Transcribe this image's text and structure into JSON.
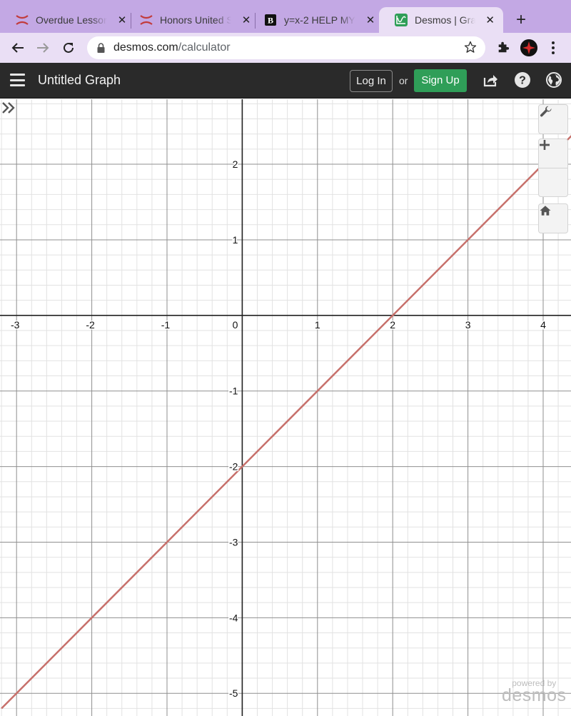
{
  "browser": {
    "tabs": [
      {
        "title": "Overdue Lessons",
        "icon": "edgenuity-x-icon",
        "active": false
      },
      {
        "title": "Honors United States",
        "icon": "edgenuity-x-icon",
        "active": false
      },
      {
        "title": "y=x-2 HELP MY",
        "icon": "brainly-b-icon",
        "active": false
      },
      {
        "title": "Desmos | Graphing Calculator",
        "icon": "desmos-icon",
        "active": true
      }
    ],
    "new_tab_label": "+",
    "close_label": "✕",
    "url_host": "desmos.com",
    "url_path": "/calculator"
  },
  "desmos": {
    "graph_title": "Untitled Graph",
    "login_label": "Log In",
    "or_label": "or",
    "signup_label": "Sign Up",
    "signup_color": "#2f9e58",
    "powered_by": "powered by",
    "brand": "desmos"
  },
  "chart_data": {
    "type": "line",
    "title": "",
    "expression": "y = x - 2",
    "series": [
      {
        "name": "y = x - 2",
        "color": "#c7706b",
        "slope": 1,
        "intercept": -2,
        "points": [
          [
            -3.2,
            -5.2
          ],
          [
            4.4,
            2.4
          ]
        ]
      }
    ],
    "xlim": [
      -3.22,
      4.37
    ],
    "ylim": [
      -5.3,
      2.86
    ],
    "x_ticks": [
      -3,
      -2,
      -1,
      1,
      2,
      3,
      4
    ],
    "y_ticks": [
      -5,
      -4,
      -3,
      -2,
      -1,
      1,
      2
    ],
    "origin_label": "0",
    "minor_step": 0.2,
    "grid": true
  }
}
